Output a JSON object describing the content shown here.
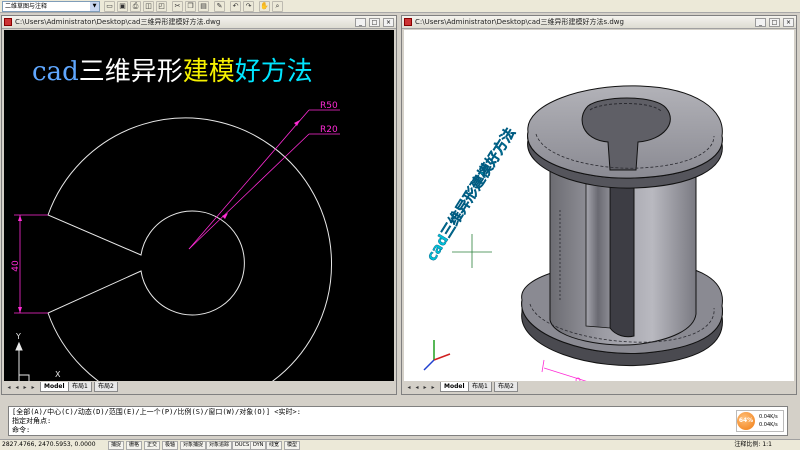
{
  "toolbar": {
    "workspace": "二维草图与注释",
    "tools": [
      "open",
      "save",
      "print",
      "plot-preview",
      "publish",
      "cut",
      "copy",
      "paste",
      "match-properties",
      "undo",
      "redo",
      "pan",
      "zoom"
    ]
  },
  "left_window": {
    "title": "C:\\Users\\Administrator\\Desktop\\cad三维异形建模好方法.dwg",
    "heading_parts": [
      {
        "text": "cad",
        "color": "#5fa7ff"
      },
      {
        "text": "三维异形",
        "color": "#ffffff"
      },
      {
        "text": "建模",
        "color": "#f5f000"
      },
      {
        "text": "好方法",
        "color": "#00e5ff"
      }
    ],
    "dimensions": {
      "outer_radius": "R50",
      "inner_radius": "R20",
      "slot_height": "40"
    },
    "ucs": {
      "x": "X",
      "y": "Y"
    },
    "tabs": [
      "Model",
      "布局1",
      "布局2"
    ]
  },
  "right_window": {
    "title": "C:\\Users\\Administrator\\Desktop\\cad三维异形建模好方法s.dwg",
    "overlay_text": "cad三维异形建模好方法",
    "tabs": [
      "Model",
      "布局1",
      "布局2"
    ]
  },
  "command": {
    "lines": [
      "[全部(A)/中心(C)/动态(D)/范围(E)/上一个(P)/比例(S)/窗口(W)/对象(O)] <实时>:",
      "指定对角点:",
      "命令:"
    ]
  },
  "speed": {
    "value": "64%",
    "up": "0.04K/s",
    "down": "0.04K/s"
  },
  "status": {
    "coords": "2827.4766, 2470.5953, 0.0000",
    "toggles": [
      "捕捉",
      "栅格",
      "正交",
      "极轴",
      "对象捕捉",
      "对象追踪",
      "DUCS",
      "DYN",
      "线宽",
      "模型"
    ],
    "scale_label": "注释比例: 1:1"
  },
  "colors": {
    "canvas_left": "#000000",
    "canvas_right": "#ffffff",
    "dimension": "#ff2bd6",
    "status_bar": "#ece9d8"
  }
}
